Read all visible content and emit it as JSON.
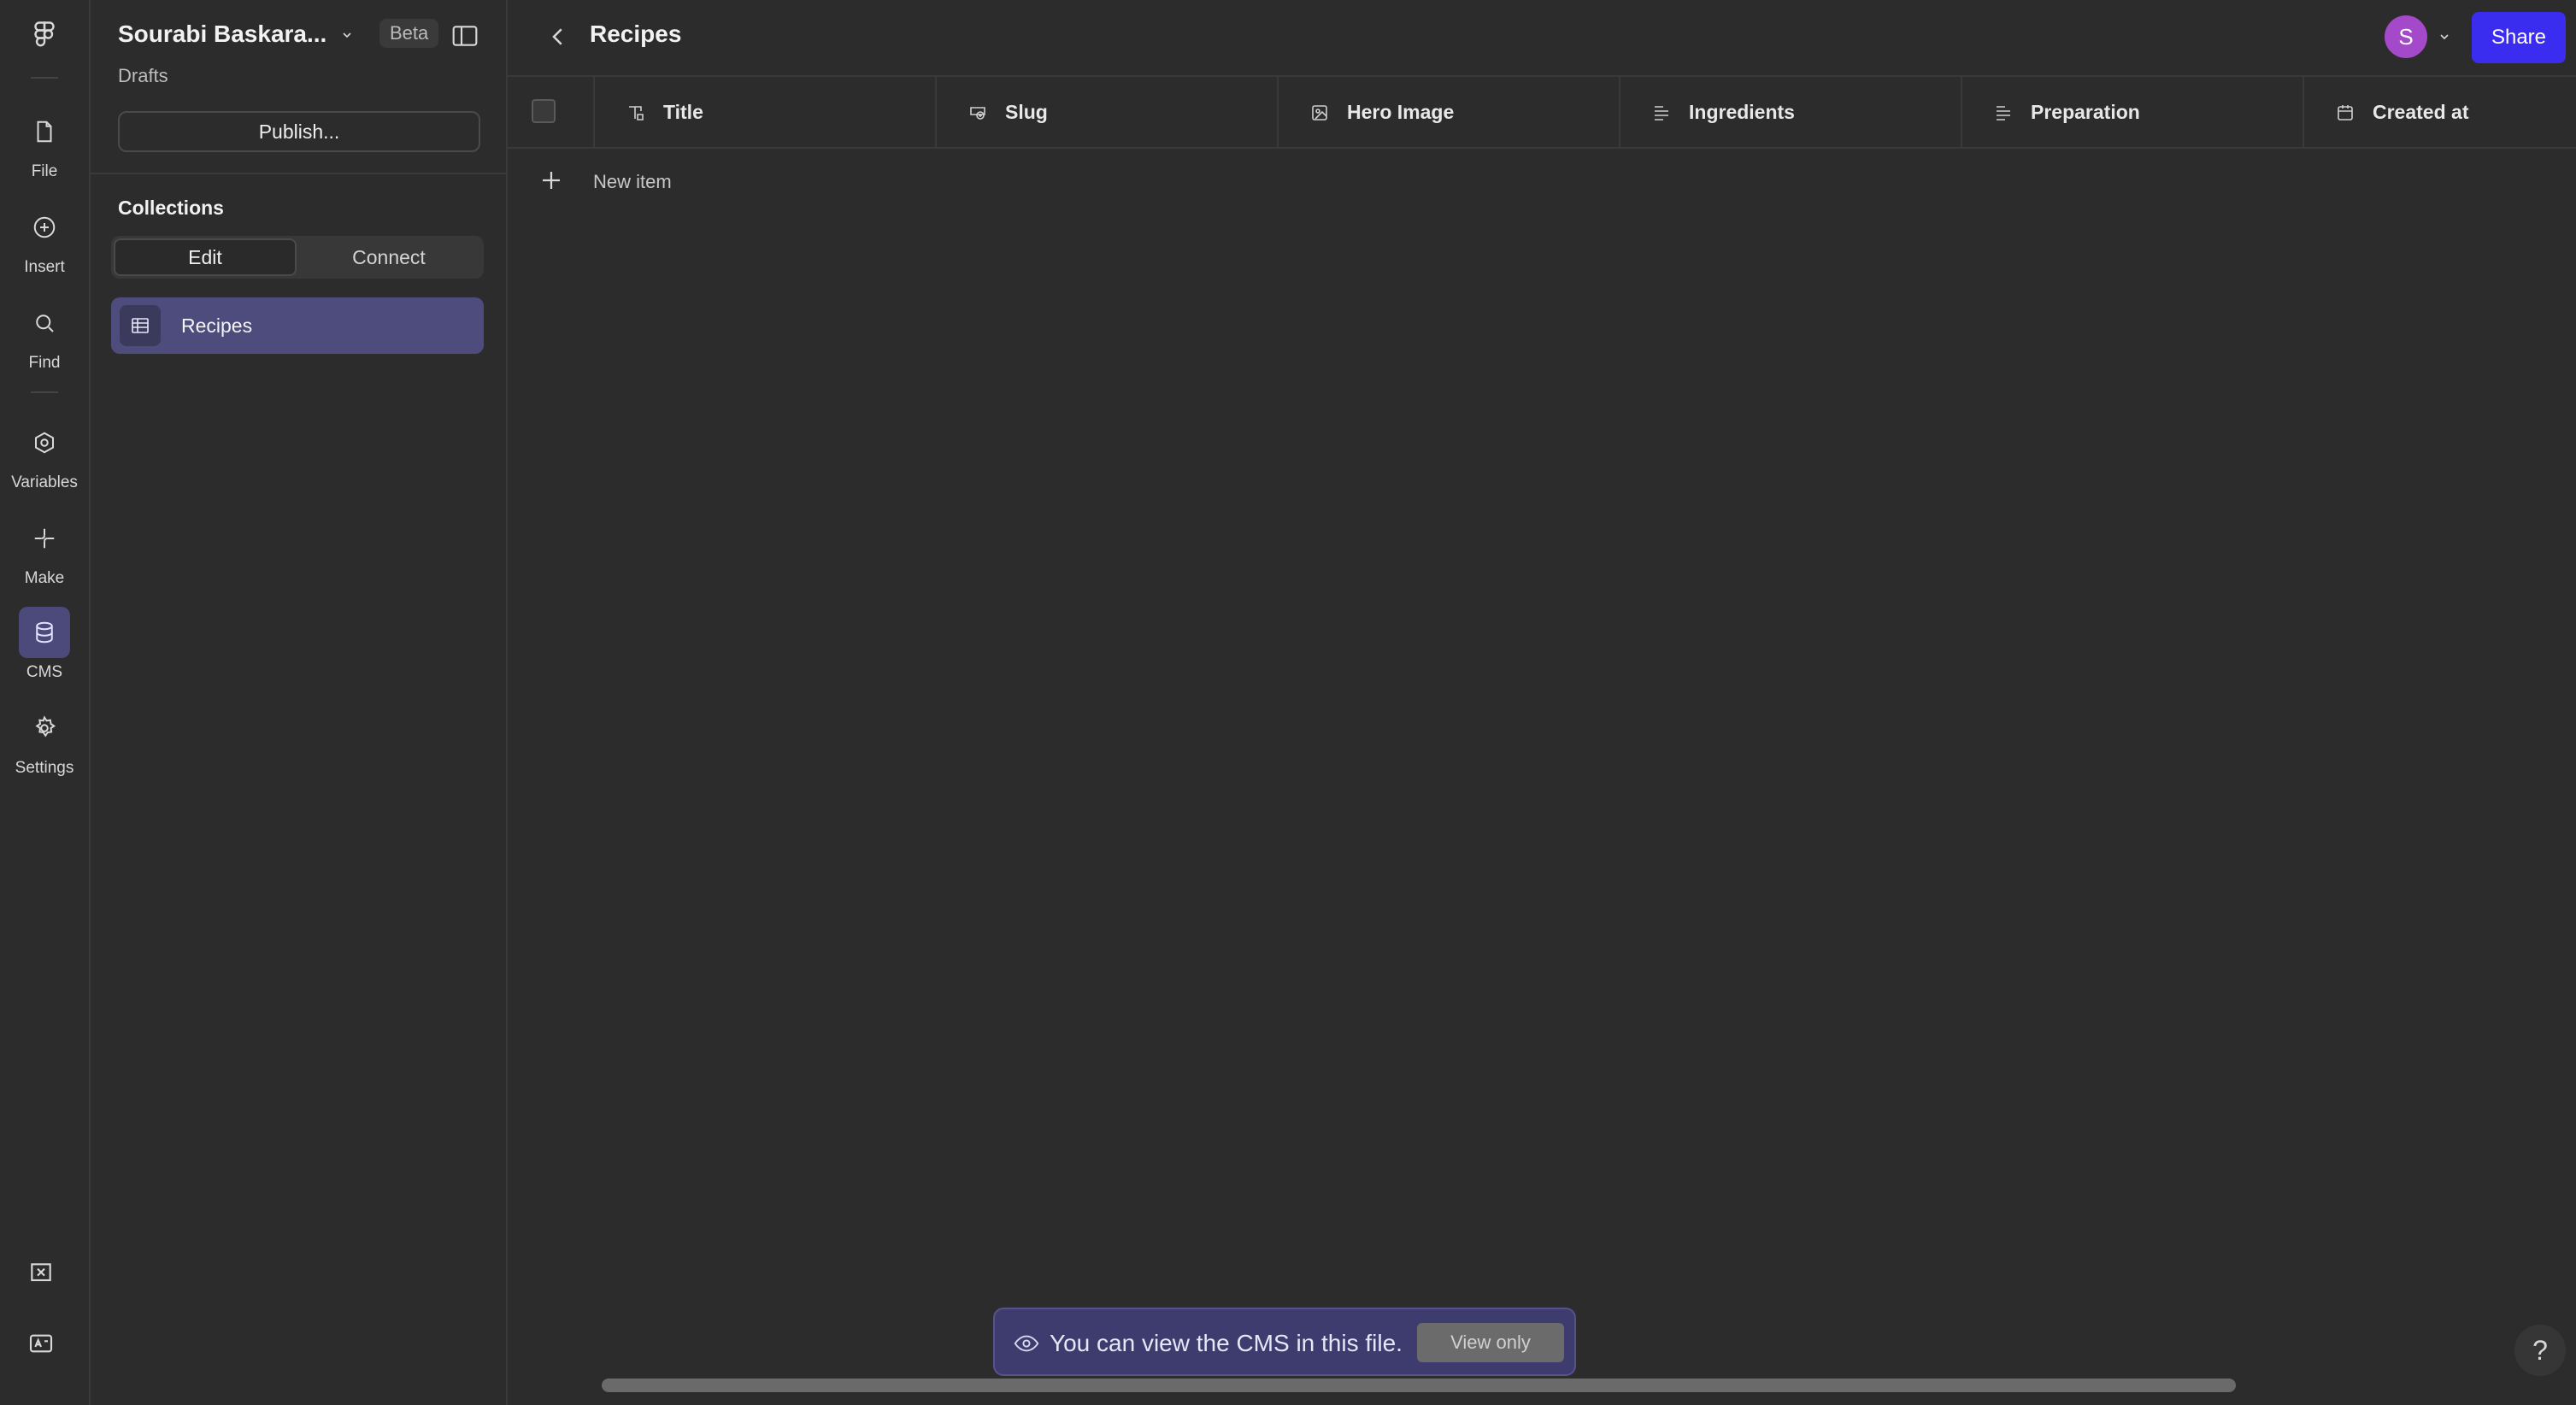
{
  "rail": {
    "items": [
      {
        "label": "File",
        "icon": "file-icon"
      },
      {
        "label": "Insert",
        "icon": "plus-circle-icon"
      },
      {
        "label": "Find",
        "icon": "search-icon"
      },
      {
        "label": "Variables",
        "icon": "variables-icon"
      },
      {
        "label": "Make",
        "icon": "make-icon"
      },
      {
        "label": "CMS",
        "icon": "database-icon",
        "active": true
      },
      {
        "label": "Settings",
        "icon": "gear-icon"
      }
    ]
  },
  "panel": {
    "file_name": "Sourabi Baskara...",
    "badge": "Beta",
    "location": "Drafts",
    "publish_label": "Publish...",
    "collections_heading": "Collections",
    "tabs": [
      "Edit",
      "Connect"
    ],
    "collections": [
      "Recipes"
    ]
  },
  "main": {
    "title": "Recipes",
    "avatar_initial": "S",
    "share_label": "Share",
    "columns": [
      {
        "label": "Title",
        "icon": "text-field-icon"
      },
      {
        "label": "Slug",
        "icon": "slug-icon"
      },
      {
        "label": "Hero Image",
        "icon": "image-icon"
      },
      {
        "label": "Ingredients",
        "icon": "rich-text-icon"
      },
      {
        "label": "Preparation",
        "icon": "rich-text-icon"
      },
      {
        "label": "Created at",
        "icon": "calendar-icon"
      }
    ],
    "new_item_label": "New item"
  },
  "toast": {
    "message": "You can view the CMS in this file.",
    "button": "View only"
  },
  "help_label": "?",
  "colors": {
    "accent": "#3b2df0",
    "active_bg": "#4e4c7d",
    "avatar": "#a349c9",
    "background": "#2c2c2c"
  }
}
